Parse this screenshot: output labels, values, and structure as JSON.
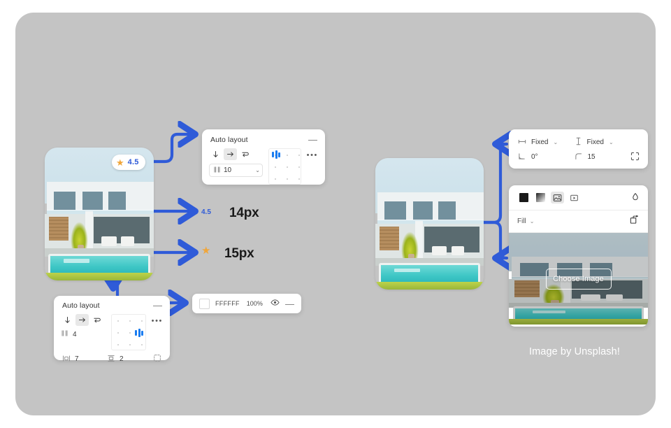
{
  "theme": {
    "backdrop_color": "#c4c4c4",
    "page_color": "#ffffff",
    "accent_blue": "#2f5bd8",
    "connector_blue": "#2f5bd8",
    "star_orange": "#f0a63a",
    "panel_white": "#ffffff"
  },
  "left_card": {
    "badge": {
      "icon": "star-icon",
      "value": "4.5"
    }
  },
  "autolayout_top": {
    "title": "Auto layout",
    "collapse_label": "—",
    "direction_icons": [
      "arrow-down-icon",
      "arrow-right-icon",
      "wrap-icon"
    ],
    "direction_selected": "arrow-right-icon",
    "gap_icon": "horizontal-gap-icon",
    "gap_value": "10",
    "caret": "⌄",
    "more_label": "•••",
    "align_grid": {
      "name": "alignment-grid",
      "selected": "top-left"
    }
  },
  "autolayout_bottom": {
    "title": "Auto layout",
    "collapse_label": "—",
    "direction_icons": [
      "arrow-down-icon",
      "arrow-right-icon",
      "wrap-icon"
    ],
    "direction_selected": "arrow-right-icon",
    "gap_icon": "horizontal-gap-icon",
    "gap_value": "4",
    "more_label": "•••",
    "horizontal_padding_icon": "horizontal-padding-icon",
    "horizontal_padding_value": "7",
    "vertical_padding_icon": "vertical-padding-icon",
    "vertical_padding_value": "2",
    "individual_padding_icon": "individual-padding-icon",
    "align_grid": {
      "name": "alignment-grid",
      "selected": "middle-right"
    }
  },
  "color_row": {
    "swatch_name": "color-swatch",
    "hex": "FFFFFF",
    "opacity": "100%",
    "visibility_icon": "eye-icon",
    "remove_label": "—"
  },
  "size_panel": {
    "width_icon": "width-icon",
    "width_value": "Fixed",
    "height_icon": "height-icon",
    "height_value": "Fixed",
    "caret": "⌄",
    "rotation_icon": "rotation-icon",
    "rotation_value": "0°",
    "corner_radius_icon": "corner-radius-icon",
    "corner_radius_value": "15",
    "independent_corners_icon": "independent-corners-icon"
  },
  "fill_panel": {
    "tabs": [
      {
        "name": "solid-fill-tab",
        "label": "solid-swatch-icon",
        "selected": false
      },
      {
        "name": "gradient-fill-tab",
        "label": "gradient-swatch-icon",
        "selected": false
      },
      {
        "name": "image-fill-tab",
        "label": "image-icon",
        "selected": true
      },
      {
        "name": "video-fill-tab",
        "label": "video-icon",
        "selected": false
      }
    ],
    "eyedropper_icon": "eyedropper-icon",
    "fill_label": "Fill",
    "caret": "⌄",
    "export_icon": "export-icon",
    "choose_image_label": "Choose Image"
  },
  "annotations": {
    "item_a": {
      "marker": "4.5",
      "label": "14px"
    },
    "item_b": {
      "marker": "star-icon",
      "label": "15px"
    }
  },
  "credit": "Image by Unsplash!"
}
